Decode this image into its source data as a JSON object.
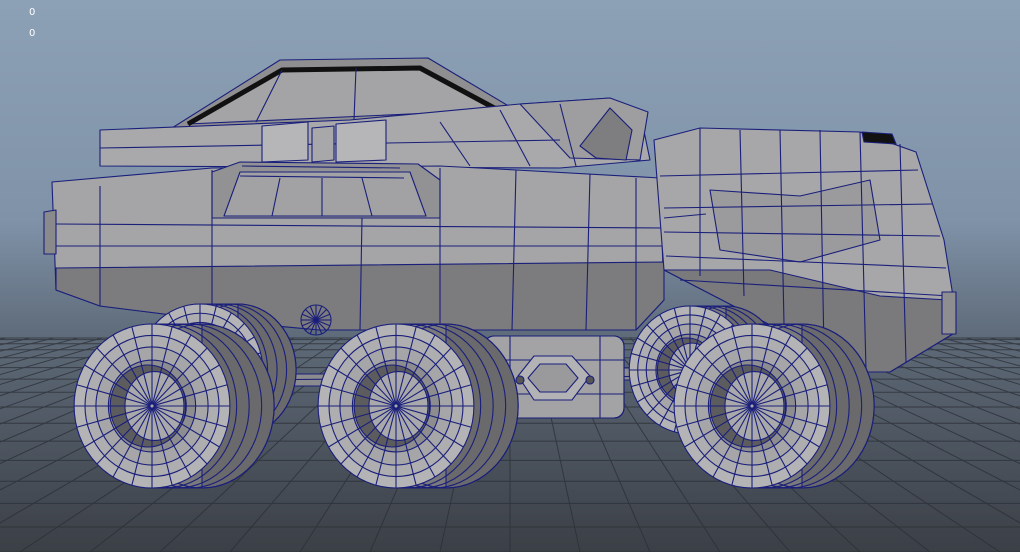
{
  "viewport": {
    "hud_readouts": [
      "0",
      "0"
    ],
    "colors": {
      "sky_top": "#8ca0b6",
      "sky_bottom": "#5d6977",
      "grid_line": "#2a2e35",
      "wireframe": "#1a1f7a",
      "mesh_light": "#b0b0b2",
      "mesh_mid": "#9a9a9c",
      "mesh_dark": "#6f6f71"
    },
    "model": "rover-vehicle-wireframe"
  }
}
